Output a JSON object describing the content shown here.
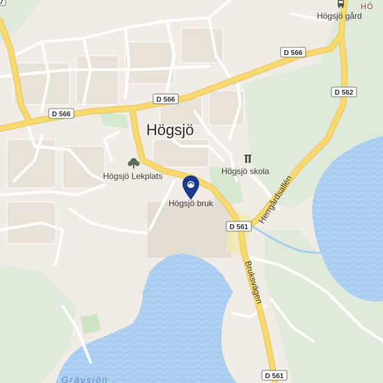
{
  "map": {
    "town_label": "Högsjö",
    "places": {
      "farm": "Högsjö gård",
      "playground": "Högsjö Lekplats",
      "school": "Högsjö skola",
      "mill": "Högsjö bruk",
      "corner_partial": "HÖ"
    },
    "roads": {
      "d566_a": "D 566",
      "d566_b": "D 566",
      "d566_c": "D 566",
      "d562": "D 562",
      "d561_a": "D 561",
      "d561_b": "D 561",
      "herrgardsallen": "Herrgårdsallén",
      "bruksvagen": "Bruksvägen",
      "corner_shield": "7"
    },
    "lakes": {
      "gravsjon": "Grävsjön"
    },
    "colors": {
      "land": "#f1ece6",
      "forest": "#dfeadb",
      "water": "#a8cdf0",
      "road_major": "#f5d56e",
      "road_minor": "#ffffff",
      "building": "#e6dfd6",
      "pin": "#1a3a8f"
    }
  }
}
